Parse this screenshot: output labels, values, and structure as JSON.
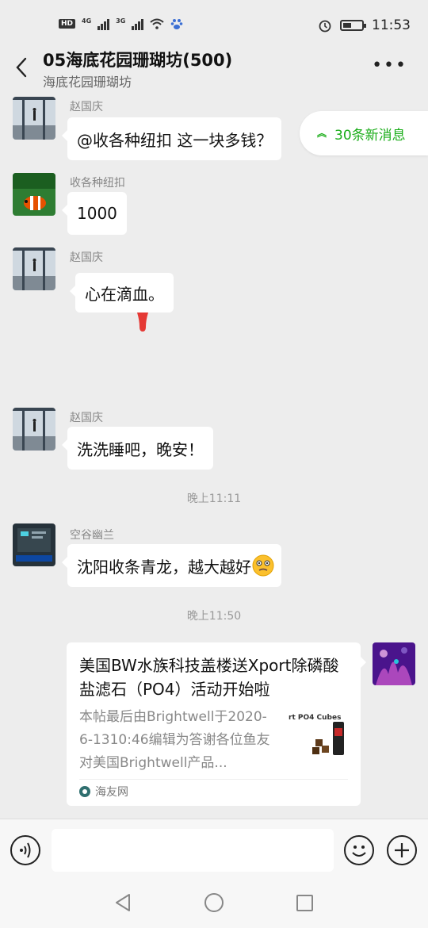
{
  "status_bar": {
    "hd_badge": "HD",
    "hd_sub": "1",
    "net1": "4G",
    "net2": "3G",
    "time": "11:53"
  },
  "header": {
    "title": "05海底花园珊瑚坊(500)",
    "subtitle": "海底花园珊瑚坊",
    "more_label": "•••"
  },
  "new_messages": {
    "label": "30条新消息"
  },
  "messages": [
    {
      "sender": "赵国庆",
      "text": "@收各种纽扣  这一块多钱？"
    },
    {
      "sender": "收各种纽扣",
      "text": "1000"
    },
    {
      "sender": "赵国庆",
      "text": "心在滴血。"
    },
    {
      "sender": "赵国庆",
      "text": "洗洗睡吧，晚安！"
    },
    {
      "sender": "空谷幽兰",
      "text": "沈阳收条青龙，越大越好"
    }
  ],
  "timestamps": [
    "晚上11:11",
    "晚上11:50"
  ],
  "shared_card": {
    "title": "美国BW水族科技盖楼送Xport除磷酸盐滤石（PO4）活动开始啦",
    "description": "本帖最后由Brightwell于2020-6-1310:46编辑为答谢各位鱼友对美国Brightwell产品...",
    "thumb_text": "rt PO4 Cubes",
    "source": "海友网"
  },
  "colors": {
    "accent_green": "#1aad19",
    "background": "#ededed"
  }
}
